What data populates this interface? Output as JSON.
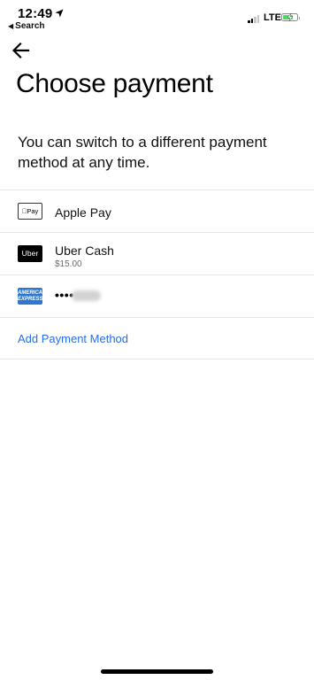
{
  "status_bar": {
    "time": "12:49",
    "back_app": "Search",
    "network": "LTE",
    "battery_level": 0.75,
    "battery_color": "#4cd964"
  },
  "header": {
    "back_icon": "arrow-left-icon",
    "title": "Choose payment",
    "subtitle": "You can switch to a different payment method at any time."
  },
  "payment_methods": [
    {
      "icon": "apple-pay-logo",
      "logo_text": "Pay",
      "label": "Apple Pay"
    },
    {
      "icon": "uber-logo",
      "logo_text": "Uber",
      "label": "Uber Cash",
      "sublabel": "$15.00"
    },
    {
      "icon": "amex-card-logo",
      "logo_text": "AMERICAN EXPRESS",
      "label": "••••",
      "accent": "#2e77d0"
    }
  ],
  "add_payment": {
    "label": "Add Payment Method",
    "color": "#276ef1"
  }
}
